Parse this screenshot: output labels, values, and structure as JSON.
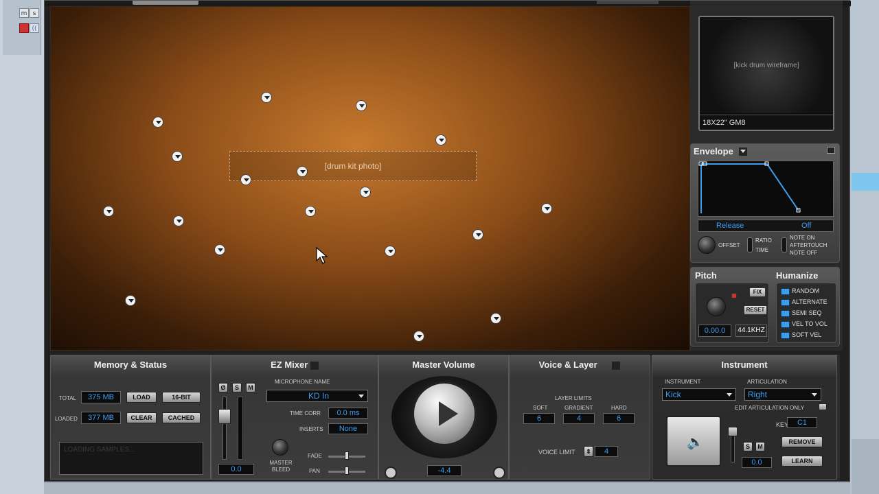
{
  "host": {
    "buttons": [
      "m",
      "s"
    ],
    "track_buttons": [
      "",
      "(("
    ]
  },
  "envelope": {
    "title": "Envelope",
    "mode": "Release",
    "state": "Off",
    "offset_label": "OFFSET",
    "ratio_label": "RATIO",
    "time_label": "TIME",
    "note_on": "NOTE ON",
    "aftertouch": "AFTERTOUCH",
    "note_off": "NOTE OFF"
  },
  "preview": {
    "caption": "18x22\" GM8"
  },
  "pitch": {
    "title": "Pitch",
    "fix": "FIX",
    "reset": "RESET",
    "value": "0.00.0",
    "rate": "44.1KHZ"
  },
  "humanize": {
    "title": "Humanize",
    "items": [
      "RANDOM",
      "ALTERNATE",
      "SEMI SEQ",
      "VEL TO VOL",
      "SOFT VEL"
    ]
  },
  "memory": {
    "title": "Memory & Status",
    "total_label": "TOTAL",
    "total_value": "375 MB",
    "loaded_label": "LOADED",
    "loaded_value": "377 MB",
    "load": "LOAD",
    "bit16": "16-BIT",
    "clear": "CLEAR",
    "cached": "CACHED",
    "status": "LOADING SAMPLES..."
  },
  "mixer": {
    "title": "EZ Mixer",
    "mic_label": "MICROPHONE NAME",
    "mic_value": "KD In",
    "time_corr_label": "TIME CORR",
    "time_corr_value": "0.0 ms",
    "inserts_label": "INSERTS",
    "inserts_value": "None",
    "fade_label": "FADE",
    "pan_label": "PAN",
    "master_bleed": "MASTER\nBLEED",
    "fader_value": "0.0",
    "btn_phase": "Ø",
    "btn_solo": "S",
    "btn_mute": "M"
  },
  "master": {
    "title": "Master Volume",
    "value": "-4.4"
  },
  "voice": {
    "title": "Voice & Layer",
    "layer_limits": "LAYER LIMITS",
    "soft_label": "SOFT",
    "soft_value": "6",
    "gradient_label": "GRADIENT",
    "gradient_value": "4",
    "hard_label": "HARD",
    "hard_value": "6",
    "voice_limit_label": "VOICE LIMIT",
    "voice_limit_value": "4"
  },
  "instrument": {
    "title": "Instrument",
    "instrument_label": "INSTRUMENT",
    "instrument_value": "Kick",
    "articulation_label": "ARTICULATION",
    "articulation_value": "Right",
    "edit_only": "EDIT ARTICULATION ONLY",
    "key_label": "KEY",
    "key_value": "C1",
    "remove": "REMOVE",
    "learn": "LEARN",
    "s": "S",
    "m": "M",
    "vel_value": "0.0"
  },
  "kit": {
    "description": "Drum kit photo: cymbals, toms, snare, kick with blue selection glow"
  },
  "colors": {
    "accent": "#3d9df0",
    "panel": "#3c3c3c",
    "stage_wood": "#c77a2e"
  }
}
